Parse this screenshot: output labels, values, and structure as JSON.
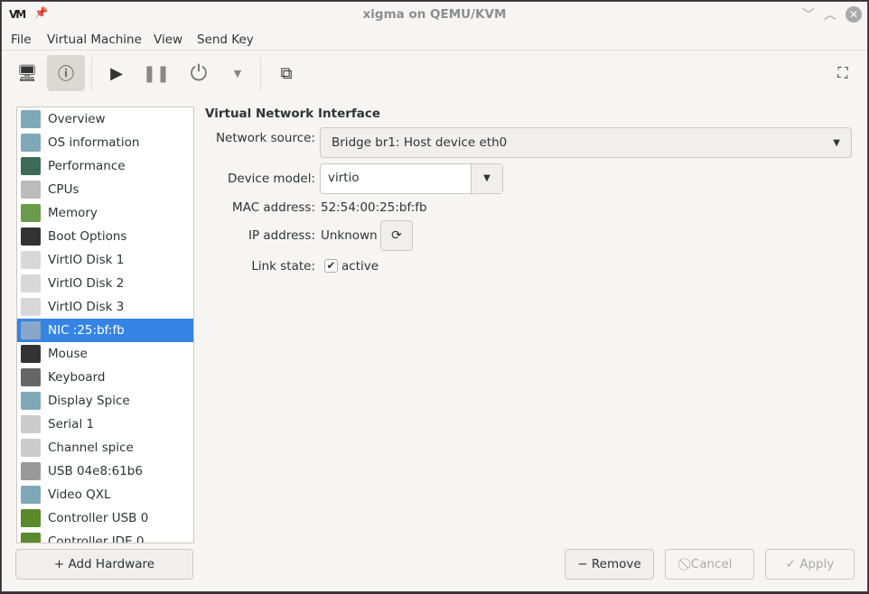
{
  "window": {
    "title": "xigma on QEMU/KVM",
    "logo": "VM"
  },
  "menu": [
    "File",
    "Virtual Machine",
    "View",
    "Send Key"
  ],
  "toolbar": [
    "console-icon",
    "details-icon",
    "play-icon",
    "pause-icon",
    "power-icon",
    "dropdown-icon",
    "snapshots-icon",
    "fullscreen-icon"
  ],
  "sidebar": {
    "items": [
      {
        "label": "Overview",
        "color": "#7fa8b8"
      },
      {
        "label": "OS information",
        "color": "#7fa8b8"
      },
      {
        "label": "Performance",
        "color": "#3d6b5a"
      },
      {
        "label": "CPUs",
        "color": "#bbbbbb"
      },
      {
        "label": "Memory",
        "color": "#6a9a4a"
      },
      {
        "label": "Boot Options",
        "color": "#333333"
      },
      {
        "label": "VirtIO Disk 1",
        "color": "#d8d8d8"
      },
      {
        "label": "VirtIO Disk 2",
        "color": "#d8d8d8"
      },
      {
        "label": "VirtIO Disk 3",
        "color": "#d8d8d8"
      },
      {
        "label": "NIC :25:bf:fb",
        "color": "#8aa6c8"
      },
      {
        "label": "Mouse",
        "color": "#333333"
      },
      {
        "label": "Keyboard",
        "color": "#666666"
      },
      {
        "label": "Display Spice",
        "color": "#7fa8b8"
      },
      {
        "label": "Serial 1",
        "color": "#cccccc"
      },
      {
        "label": "Channel spice",
        "color": "#cccccc"
      },
      {
        "label": "USB 04e8:61b6",
        "color": "#999999"
      },
      {
        "label": "Video QXL",
        "color": "#7fa8b8"
      },
      {
        "label": "Controller USB 0",
        "color": "#5a8a2a"
      },
      {
        "label": "Controller IDE 0",
        "color": "#5a8a2a"
      }
    ],
    "selected": "NIC :25:bf:fb",
    "add_hardware": "+ Add Hardware"
  },
  "detail": {
    "heading": "Virtual Network Interface",
    "network_source_label": "Network source:",
    "network_source": "Bridge br1: Host device eth0",
    "device_model_label": "Device model:",
    "device_model": "virtio",
    "mac_label": "MAC address:",
    "mac": "52:54:00:25:bf:fb",
    "ip_label": "IP address:",
    "ip": "Unknown",
    "link_label": "Link state:",
    "link_checked": true,
    "link_text": "active"
  },
  "buttons": {
    "remove": "− Remove",
    "cancel": "⃠ Cancel",
    "apply": "✓ Apply"
  },
  "accent": "#3584e4"
}
